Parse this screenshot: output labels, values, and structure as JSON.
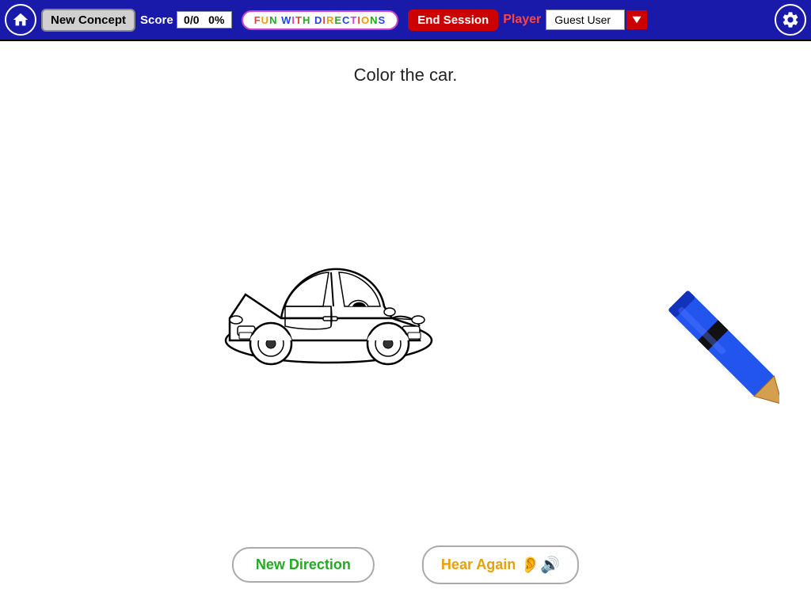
{
  "header": {
    "home_label": "Home",
    "new_concept_label": "New Concept",
    "score_label": "Score",
    "score_value": "0/0",
    "score_percent": "0%",
    "app_title": "FUN WITH DIRECTIONS",
    "end_session_label": "End Session",
    "player_label": "Player",
    "user_name": "Guest User",
    "settings_label": "Settings"
  },
  "main": {
    "instruction": "Color the car.",
    "new_direction_label": "New Direction",
    "hear_again_label": "Hear Again"
  }
}
